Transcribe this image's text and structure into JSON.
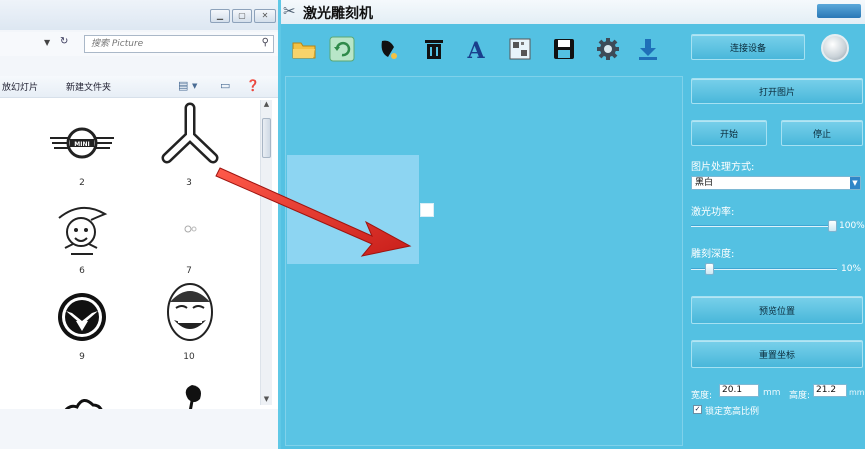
{
  "explorer": {
    "search_placeholder": "搜索 Picture",
    "toolbar_left": "放幻灯片",
    "toolbar_new_folder": "新建文件夹",
    "thumbnails": [
      {
        "label": "2",
        "icon": "mini-logo-icon"
      },
      {
        "label": "3",
        "icon": "trefoil-knot-icon"
      },
      {
        "label": "6",
        "icon": "cartoon-character-icon"
      },
      {
        "label": "7",
        "icon": "blank-image-icon"
      },
      {
        "label": "9",
        "icon": "shield-eagle-icon"
      },
      {
        "label": "10",
        "icon": "meme-face-icon"
      },
      {
        "label": "",
        "icon": "cartoon-partial-icon"
      },
      {
        "label": "",
        "icon": "rose-icon"
      }
    ]
  },
  "app": {
    "title": "激光雕刻机",
    "tools": [
      "open-folder-icon",
      "refresh-icon",
      "brush-icon",
      "trash-icon",
      "text-icon",
      "bitmap-icon",
      "save-icon",
      "settings-icon",
      "download-icon"
    ],
    "connect_label": "连接设备",
    "open_image_label": "打开图片",
    "start_label": "开始",
    "stop_label": "停止",
    "processing_label": "图片处理方式:",
    "processing_value": "黑白",
    "power_label": "激光功率:",
    "power_value": "100%",
    "power_level": 1.0,
    "depth_label": "雕刻深度:",
    "depth_value": "10%",
    "depth_level": 0.1,
    "preview_label": "预览位置",
    "reset_label": "重置坐标",
    "width_label": "宽度:",
    "width_value": "20.1",
    "height_label": "高度:",
    "height_value": "21.2",
    "unit": "mm",
    "lock_ratio_label": "锁定宽高比例",
    "colors": {
      "app_background": "#54c1e2",
      "canvas": "#5ac4e4",
      "image_region": "#8dd5f2",
      "arrow": "#e3322b"
    }
  }
}
